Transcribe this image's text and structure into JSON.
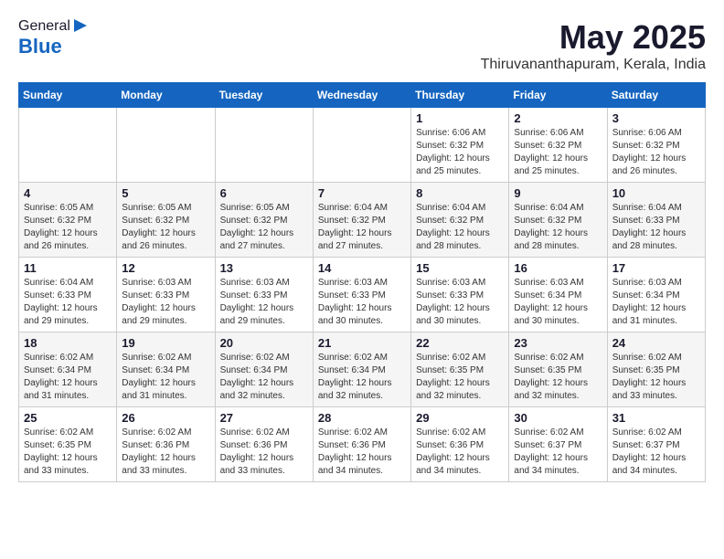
{
  "logo": {
    "general": "General",
    "blue": "Blue"
  },
  "title": {
    "month_year": "May 2025",
    "location": "Thiruvananthapuram, Kerala, India"
  },
  "weekdays": [
    "Sunday",
    "Monday",
    "Tuesday",
    "Wednesday",
    "Thursday",
    "Friday",
    "Saturday"
  ],
  "days": [
    {
      "date": "",
      "info": ""
    },
    {
      "date": "",
      "info": ""
    },
    {
      "date": "",
      "info": ""
    },
    {
      "date": "",
      "info": ""
    },
    {
      "date": "1",
      "info": "Sunrise: 6:06 AM\nSunset: 6:32 PM\nDaylight: 12 hours\nand 25 minutes."
    },
    {
      "date": "2",
      "info": "Sunrise: 6:06 AM\nSunset: 6:32 PM\nDaylight: 12 hours\nand 25 minutes."
    },
    {
      "date": "3",
      "info": "Sunrise: 6:06 AM\nSunset: 6:32 PM\nDaylight: 12 hours\nand 26 minutes."
    },
    {
      "date": "4",
      "info": "Sunrise: 6:05 AM\nSunset: 6:32 PM\nDaylight: 12 hours\nand 26 minutes."
    },
    {
      "date": "5",
      "info": "Sunrise: 6:05 AM\nSunset: 6:32 PM\nDaylight: 12 hours\nand 26 minutes."
    },
    {
      "date": "6",
      "info": "Sunrise: 6:05 AM\nSunset: 6:32 PM\nDaylight: 12 hours\nand 27 minutes."
    },
    {
      "date": "7",
      "info": "Sunrise: 6:04 AM\nSunset: 6:32 PM\nDaylight: 12 hours\nand 27 minutes."
    },
    {
      "date": "8",
      "info": "Sunrise: 6:04 AM\nSunset: 6:32 PM\nDaylight: 12 hours\nand 28 minutes."
    },
    {
      "date": "9",
      "info": "Sunrise: 6:04 AM\nSunset: 6:32 PM\nDaylight: 12 hours\nand 28 minutes."
    },
    {
      "date": "10",
      "info": "Sunrise: 6:04 AM\nSunset: 6:33 PM\nDaylight: 12 hours\nand 28 minutes."
    },
    {
      "date": "11",
      "info": "Sunrise: 6:04 AM\nSunset: 6:33 PM\nDaylight: 12 hours\nand 29 minutes."
    },
    {
      "date": "12",
      "info": "Sunrise: 6:03 AM\nSunset: 6:33 PM\nDaylight: 12 hours\nand 29 minutes."
    },
    {
      "date": "13",
      "info": "Sunrise: 6:03 AM\nSunset: 6:33 PM\nDaylight: 12 hours\nand 29 minutes."
    },
    {
      "date": "14",
      "info": "Sunrise: 6:03 AM\nSunset: 6:33 PM\nDaylight: 12 hours\nand 30 minutes."
    },
    {
      "date": "15",
      "info": "Sunrise: 6:03 AM\nSunset: 6:33 PM\nDaylight: 12 hours\nand 30 minutes."
    },
    {
      "date": "16",
      "info": "Sunrise: 6:03 AM\nSunset: 6:34 PM\nDaylight: 12 hours\nand 30 minutes."
    },
    {
      "date": "17",
      "info": "Sunrise: 6:03 AM\nSunset: 6:34 PM\nDaylight: 12 hours\nand 31 minutes."
    },
    {
      "date": "18",
      "info": "Sunrise: 6:02 AM\nSunset: 6:34 PM\nDaylight: 12 hours\nand 31 minutes."
    },
    {
      "date": "19",
      "info": "Sunrise: 6:02 AM\nSunset: 6:34 PM\nDaylight: 12 hours\nand 31 minutes."
    },
    {
      "date": "20",
      "info": "Sunrise: 6:02 AM\nSunset: 6:34 PM\nDaylight: 12 hours\nand 32 minutes."
    },
    {
      "date": "21",
      "info": "Sunrise: 6:02 AM\nSunset: 6:34 PM\nDaylight: 12 hours\nand 32 minutes."
    },
    {
      "date": "22",
      "info": "Sunrise: 6:02 AM\nSunset: 6:35 PM\nDaylight: 12 hours\nand 32 minutes."
    },
    {
      "date": "23",
      "info": "Sunrise: 6:02 AM\nSunset: 6:35 PM\nDaylight: 12 hours\nand 32 minutes."
    },
    {
      "date": "24",
      "info": "Sunrise: 6:02 AM\nSunset: 6:35 PM\nDaylight: 12 hours\nand 33 minutes."
    },
    {
      "date": "25",
      "info": "Sunrise: 6:02 AM\nSunset: 6:35 PM\nDaylight: 12 hours\nand 33 minutes."
    },
    {
      "date": "26",
      "info": "Sunrise: 6:02 AM\nSunset: 6:36 PM\nDaylight: 12 hours\nand 33 minutes."
    },
    {
      "date": "27",
      "info": "Sunrise: 6:02 AM\nSunset: 6:36 PM\nDaylight: 12 hours\nand 33 minutes."
    },
    {
      "date": "28",
      "info": "Sunrise: 6:02 AM\nSunset: 6:36 PM\nDaylight: 12 hours\nand 34 minutes."
    },
    {
      "date": "29",
      "info": "Sunrise: 6:02 AM\nSunset: 6:36 PM\nDaylight: 12 hours\nand 34 minutes."
    },
    {
      "date": "30",
      "info": "Sunrise: 6:02 AM\nSunset: 6:37 PM\nDaylight: 12 hours\nand 34 minutes."
    },
    {
      "date": "31",
      "info": "Sunrise: 6:02 AM\nSunset: 6:37 PM\nDaylight: 12 hours\nand 34 minutes."
    }
  ]
}
